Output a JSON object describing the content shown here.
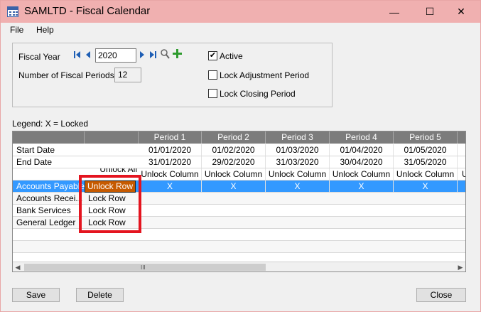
{
  "window": {
    "title": "SAMLTD - Fiscal Calendar",
    "controls": {
      "minimize": "—",
      "maximize": "☐",
      "close": "✕"
    },
    "accent_color": "#f0b0b0"
  },
  "menu": [
    "File",
    "Help"
  ],
  "form": {
    "fiscal_year_label": "Fiscal Year",
    "fiscal_year_value": "2020",
    "periods_label": "Number of Fiscal Periods",
    "periods_value": "12",
    "active_label": "Active",
    "active_checked": true,
    "lock_adjustment_label": "Lock Adjustment Period",
    "lock_closing_label": "Lock Closing Period",
    "nav_icons": [
      "first-icon",
      "previous-icon",
      "next-icon",
      "last-icon",
      "finder-icon",
      "new-icon"
    ]
  },
  "legend": "Legend: X = Locked",
  "grid": {
    "columns": [
      "Period 1",
      "Period 2",
      "Period 3",
      "Period 4",
      "Period 5"
    ],
    "start_date_label": "Start Date",
    "start_dates": [
      "01/01/2020",
      "01/02/2020",
      "01/03/2020",
      "01/04/2020",
      "01/05/2020"
    ],
    "end_date_label": "End Date",
    "end_dates": [
      "31/01/2020",
      "29/02/2020",
      "31/03/2020",
      "30/04/2020",
      "31/05/2020"
    ],
    "unlock_all_label": "Unlock All",
    "unlock_column_label": "Unlock Column",
    "rows": [
      {
        "label": "Accounts Payable",
        "button": "Unlock Row",
        "cells": [
          "X",
          "X",
          "X",
          "X",
          "X"
        ],
        "selected": true
      },
      {
        "label": "Accounts Recei...",
        "button": "Lock Row",
        "cells": [
          "",
          "",
          "",
          "",
          ""
        ]
      },
      {
        "label": "Bank Services",
        "button": "Lock Row",
        "cells": [
          "",
          "",
          "",
          "",
          ""
        ]
      },
      {
        "label": "General Ledger",
        "button": "Lock Row",
        "cells": [
          "",
          "",
          "",
          "",
          ""
        ]
      }
    ],
    "selection_color": "#3399ff",
    "unlock_button_color": "#c65a00",
    "highlight_color": "#e4141f",
    "scroll_grip": "III"
  },
  "buttons": {
    "save": "Save",
    "delete": "Delete",
    "close": "Close"
  }
}
